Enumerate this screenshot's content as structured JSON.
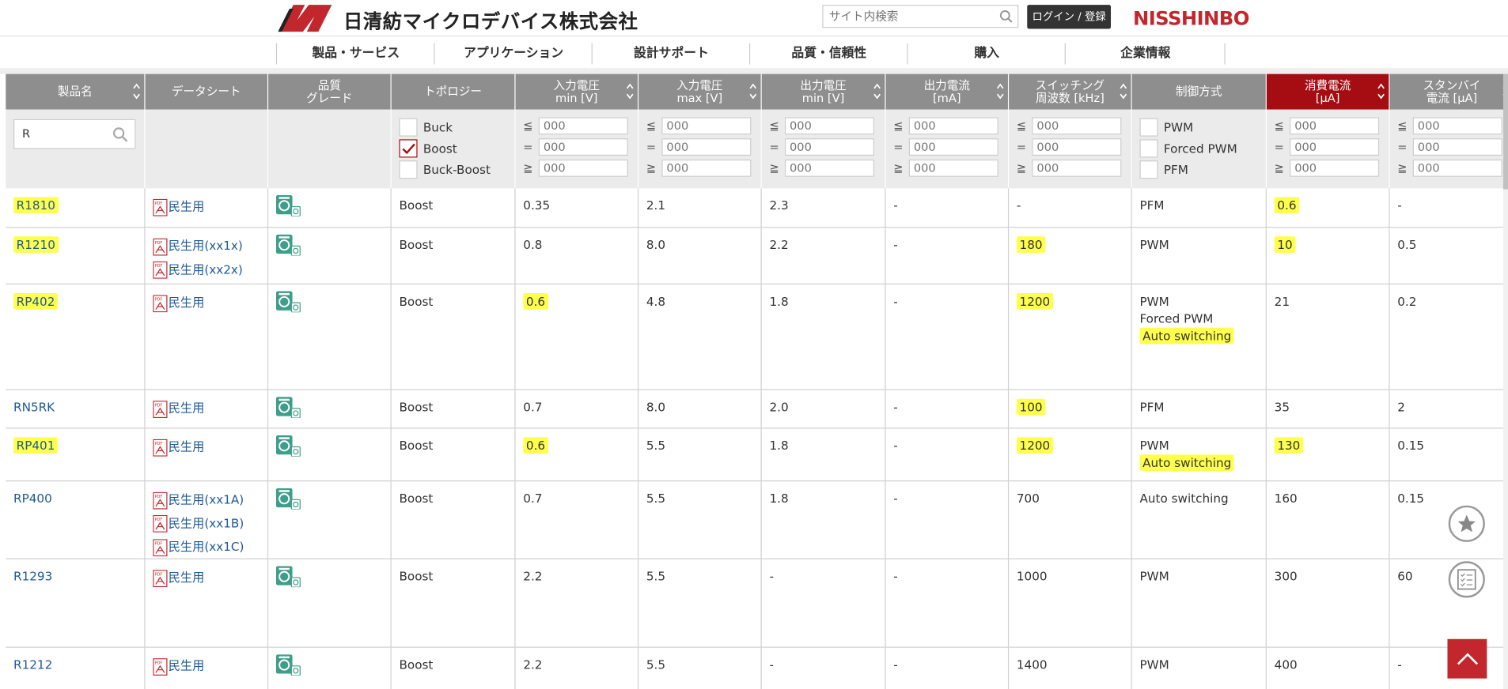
{
  "header": {
    "company_name": "日清紡マイクロデバイス株式会社",
    "search_placeholder": "サイト内検索",
    "login_label": "ログイン / 登録",
    "brand": "NISSHINBO"
  },
  "nav": [
    "製品・サービス",
    "アプリケーション",
    "設計サポート",
    "品質・信頼性",
    "購入",
    "企業情報"
  ],
  "columns": [
    {
      "label": "製品名",
      "sortable": true
    },
    {
      "label": "データシート",
      "sortable": false
    },
    {
      "label": "品質\nグレード",
      "sortable": false
    },
    {
      "label": "トポロジー",
      "sortable": false
    },
    {
      "label": "入力電圧\nmin [V]",
      "sortable": true
    },
    {
      "label": "入力電圧\nmax [V]",
      "sortable": true
    },
    {
      "label": "出力電圧\nmin [V]",
      "sortable": true
    },
    {
      "label": "出力電流\n[mA]",
      "sortable": true
    },
    {
      "label": "スイッチング\n周波数 [kHz]",
      "sortable": true
    },
    {
      "label": "制御方式",
      "sortable": false
    },
    {
      "label": "消費電流\n[μA]",
      "sortable": true,
      "active": true
    },
    {
      "label": "スタンバイ\n電流 [μA]",
      "sortable": true
    }
  ],
  "filters": {
    "product_search": "R",
    "topology": [
      {
        "label": "Buck",
        "checked": false
      },
      {
        "label": "Boost",
        "checked": true
      },
      {
        "label": "Buck-Boost",
        "checked": false
      }
    ],
    "control": [
      {
        "label": "PWM",
        "checked": false
      },
      {
        "label": "Forced PWM",
        "checked": false
      },
      {
        "label": "PFM",
        "checked": false
      }
    ],
    "operators": [
      "≦",
      "=",
      "≧"
    ],
    "input_placeholder": "000"
  },
  "rows": [
    {
      "name": "R1810",
      "name_hl": true,
      "datasheets": [
        "民生用"
      ],
      "topology": "Boost",
      "vin_min": "0.35",
      "vin_max": "2.1",
      "vout_min": "2.3",
      "iout": "-",
      "freq": "-",
      "control": [
        "PFM"
      ],
      "iq": "0.6",
      "iq_hl": true,
      "standby": "-"
    },
    {
      "name": "R1210",
      "name_hl": true,
      "datasheets": [
        "民生用(xx1x)",
        "民生用(xx2x)"
      ],
      "topology": "Boost",
      "vin_min": "0.8",
      "vin_max": "8.0",
      "vout_min": "2.2",
      "iout": "-",
      "freq": "180",
      "freq_hl": true,
      "control": [
        "PWM"
      ],
      "iq": "10",
      "iq_hl": true,
      "standby": "0.5"
    },
    {
      "name": "RP402",
      "name_hl": true,
      "datasheets": [
        "民生用"
      ],
      "topology": "Boost",
      "vin_min": "0.6",
      "vin_min_hl": true,
      "vin_max": "4.8",
      "vout_min": "1.8",
      "iout": "-",
      "freq": "1200",
      "freq_hl": true,
      "control": [
        "PWM",
        "Forced PWM",
        "Auto switching"
      ],
      "control_hl": [
        false,
        false,
        true
      ],
      "iq": "21",
      "standby": "0.2"
    },
    {
      "name": "RN5RK",
      "datasheets": [
        "民生用"
      ],
      "topology": "Boost",
      "vin_min": "0.7",
      "vin_max": "8.0",
      "vout_min": "2.0",
      "iout": "-",
      "freq": "100",
      "freq_hl": true,
      "control": [
        "PFM"
      ],
      "iq": "35",
      "standby": "2"
    },
    {
      "name": "RP401",
      "name_hl": true,
      "datasheets": [
        "民生用"
      ],
      "topology": "Boost",
      "vin_min": "0.6",
      "vin_min_hl": true,
      "vin_max": "5.5",
      "vout_min": "1.8",
      "iout": "-",
      "freq": "1200",
      "freq_hl": true,
      "control": [
        "PWM",
        "Auto switching"
      ],
      "control_hl": [
        false,
        true
      ],
      "iq": "130",
      "iq_hl": true,
      "standby": "0.15"
    },
    {
      "name": "RP400",
      "datasheets": [
        "民生用(xx1A)",
        "民生用(xx1B)",
        "民生用(xx1C)"
      ],
      "topology": "Boost",
      "vin_min": "0.7",
      "vin_max": "5.5",
      "vout_min": "1.8",
      "iout": "-",
      "freq": "700",
      "control": [
        "Auto switching"
      ],
      "iq": "160",
      "standby": "0.15"
    },
    {
      "name": "R1293",
      "datasheets": [
        "民生用"
      ],
      "topology": "Boost",
      "vin_min": "2.2",
      "vin_max": "5.5",
      "vout_min": "-",
      "iout": "-",
      "freq": "1000",
      "control": [
        "PWM"
      ],
      "iq": "300",
      "standby": "60"
    },
    {
      "name": "R1212",
      "datasheets": [
        "民生用"
      ],
      "topology": "Boost",
      "vin_min": "2.2",
      "vin_max": "5.5",
      "vout_min": "-",
      "iout": "-",
      "freq": "1400",
      "control": [
        "PWM"
      ],
      "iq": "400",
      "standby": "-"
    }
  ],
  "colors": {
    "accent": "#a50d12",
    "header_bg": "#8e8e8e",
    "link": "#1e5a96",
    "highlight": "#ffff4d"
  },
  "icons": {
    "favorite": "star-icon",
    "list": "checklist-icon",
    "top": "chevron-up-icon"
  }
}
